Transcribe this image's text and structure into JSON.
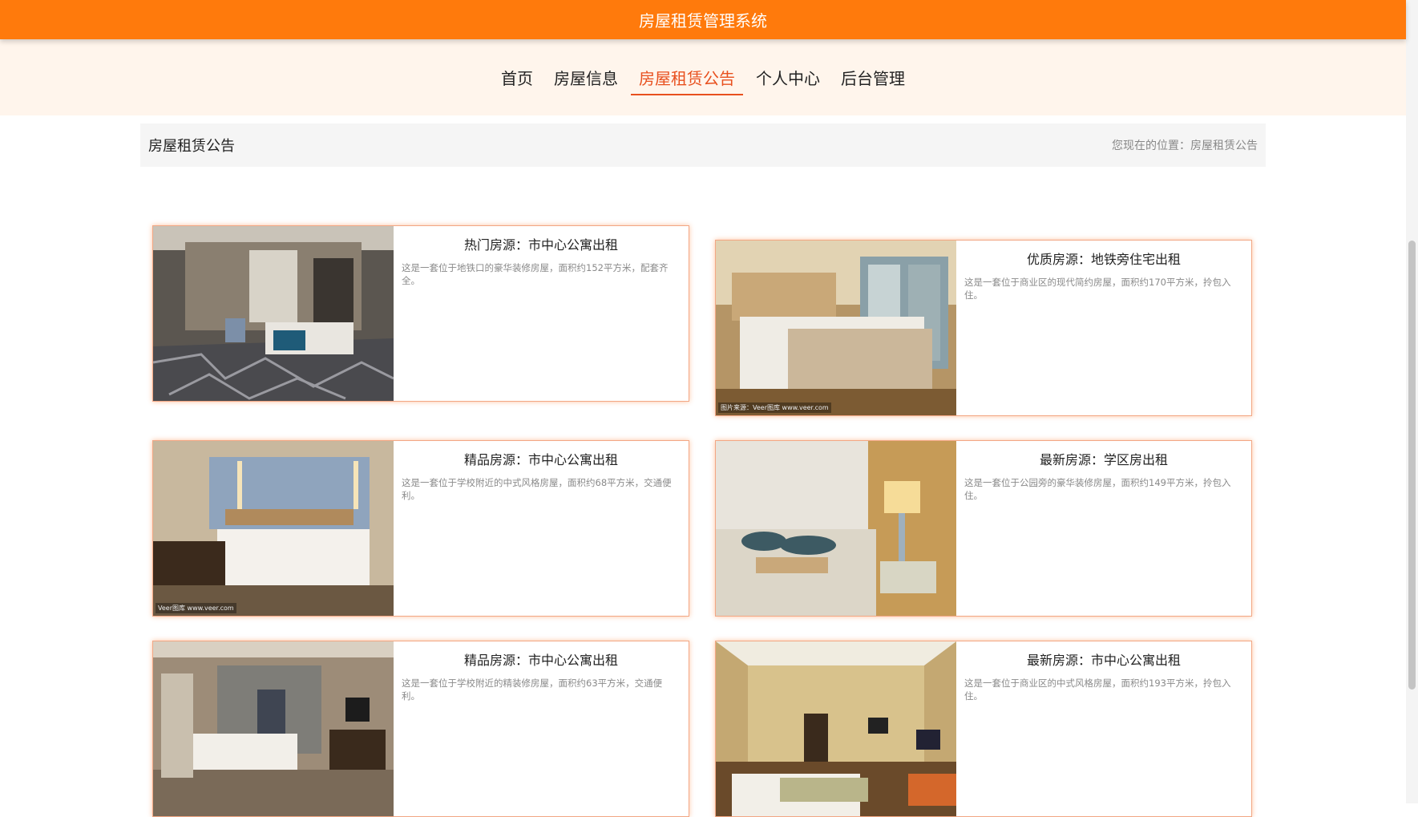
{
  "header": {
    "title": "房屋租赁管理系统"
  },
  "nav": {
    "items": [
      {
        "label": "首页",
        "active": false
      },
      {
        "label": "房屋信息",
        "active": false
      },
      {
        "label": "房屋租赁公告",
        "active": true
      },
      {
        "label": "个人中心",
        "active": false
      },
      {
        "label": "后台管理",
        "active": false
      }
    ]
  },
  "breadcrumb": {
    "page_title": "房屋租赁公告",
    "location": "您现在的位置：房屋租赁公告"
  },
  "cards": [
    {
      "title": "热门房源：市中心公寓出租",
      "desc": "这是一套位于地铁口的豪华装修房屋，面积约152平方米，配套齐全。"
    },
    {
      "title": "优质房源：地铁旁住宅出租",
      "desc": "这是一套位于商业区的现代简约房屋，面积约170平方米，拎包入住。"
    },
    {
      "title": "精品房源：市中心公寓出租",
      "desc": "这是一套位于学校附近的中式风格房屋，面积约68平方米，交通便利。"
    },
    {
      "title": "最新房源：学区房出租",
      "desc": "这是一套位于公园旁的豪华装修房屋，面积约149平方米，拎包入住。"
    },
    {
      "title": "精品房源：市中心公寓出租",
      "desc": "这是一套位于学校附近的精装修房屋，面积约63平方米，交通便利。"
    },
    {
      "title": "最新房源：市中心公寓出租",
      "desc": "这是一套位于商业区的中式风格房屋，面积约193平方米，拎包入住。"
    }
  ],
  "watermarks": {
    "card2": "图片来源：Veer图库 www.veer.com",
    "card3": "Veer图库 www.veer.com"
  },
  "colors": {
    "brand": "#ff7a0c",
    "active_nav": "#e8501e",
    "card_border": "#f2a784"
  }
}
